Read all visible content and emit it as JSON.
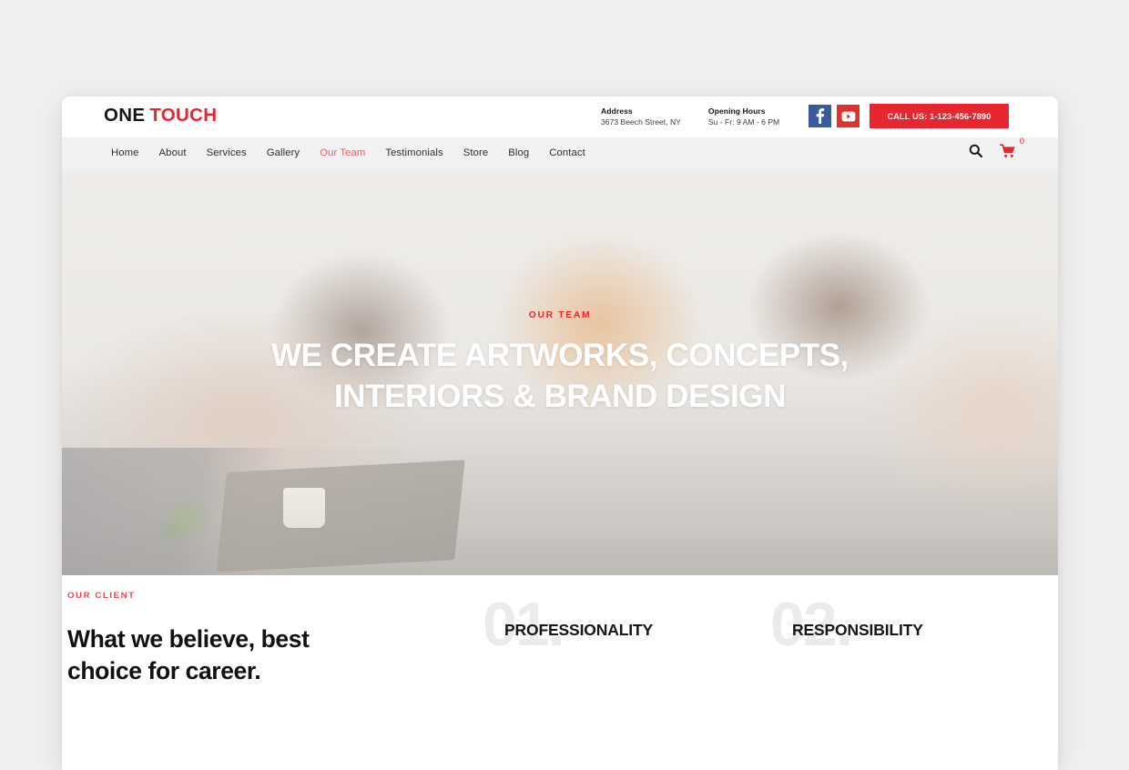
{
  "page": {
    "background_color": "#f0f0f0"
  },
  "site": {
    "accent_color": "#e8262f",
    "header": {
      "logo": {
        "part1": "ONE",
        "part2": "TOUCH"
      },
      "info": [
        {
          "title": "Address",
          "text": "3673 Beech Street, NY"
        },
        {
          "title": "Opening Hours",
          "text": "Su - Fr: 9 AM - 6 PM"
        }
      ],
      "social": [
        {
          "name": "facebook-icon",
          "glyph": "f",
          "color": "#3b5a9a"
        },
        {
          "name": "youtube-icon",
          "glyph": "▶",
          "color": "#e03030"
        }
      ],
      "call_button": "CALL US: 1-123-456-7890"
    },
    "nav": {
      "items": [
        {
          "label": "Home",
          "active": false
        },
        {
          "label": "About",
          "active": false
        },
        {
          "label": "Services",
          "active": false
        },
        {
          "label": "Gallery",
          "active": false
        },
        {
          "label": "Our Team",
          "active": true
        },
        {
          "label": "Testimonials",
          "active": false
        },
        {
          "label": "Store",
          "active": false
        },
        {
          "label": "Blog",
          "active": false
        },
        {
          "label": "Contact",
          "active": false
        }
      ],
      "search_icon": "search-icon",
      "cart_icon": "shopping-cart-icon",
      "cart_count": "0"
    },
    "hero": {
      "eyebrow": "OUR TEAM",
      "title_line1": "WE CREATE ARTWORKS, CONCEPTS,",
      "title_line2": "INTERIORS & BRAND DESIGN"
    },
    "content": {
      "client_eyebrow": "OUR CLIENT",
      "client_heading_line1": "What we believe, best",
      "client_heading_line2": "choice for career.",
      "features": [
        {
          "number": "01.",
          "label": "PROFESSIONALITY"
        },
        {
          "number": "02.",
          "label": "RESPONSIBILITY"
        }
      ]
    }
  }
}
